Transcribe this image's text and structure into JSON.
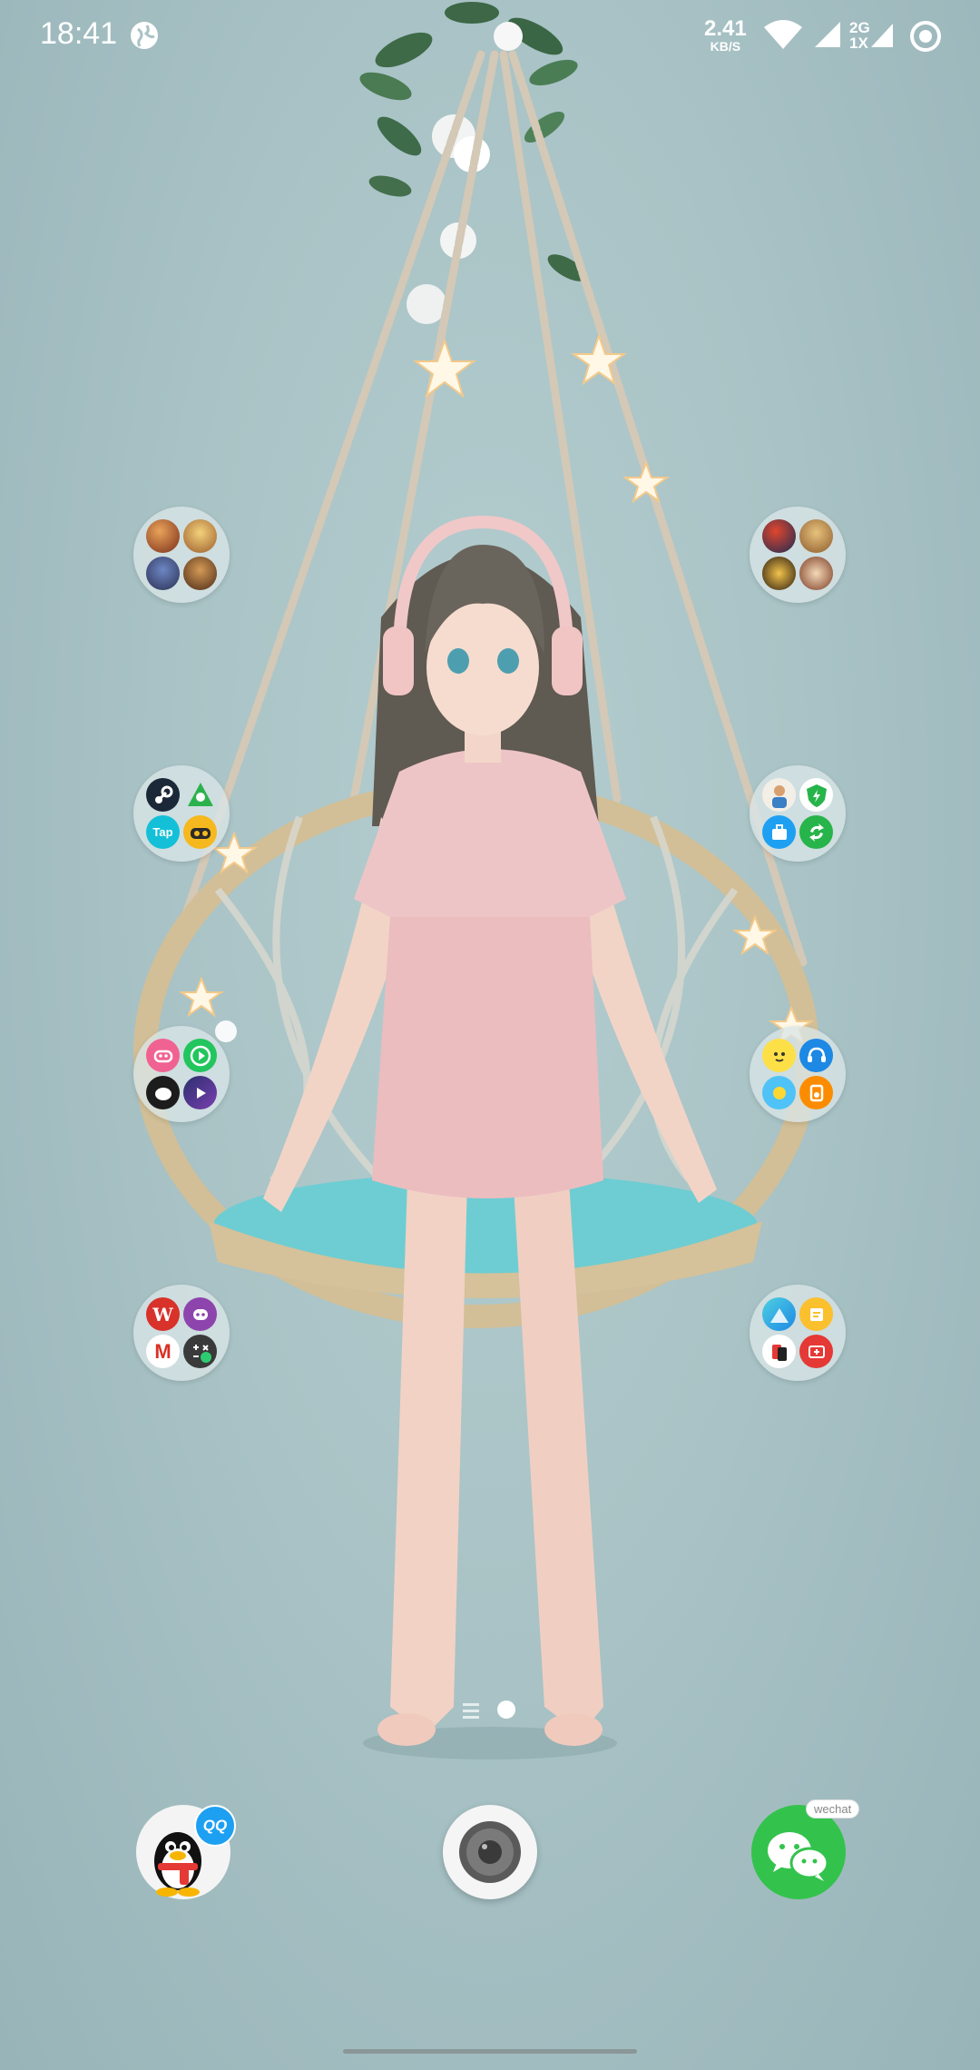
{
  "status_bar": {
    "time": "18:41",
    "network_speed": "2.41",
    "network_speed_unit": "KB/S",
    "signal_label_top": "2G",
    "signal_label_bottom": "1X",
    "icons": [
      "globe-icon",
      "wifi-icon",
      "signal-icon",
      "signal-2g-icon",
      "sync-icon"
    ]
  },
  "folders": [
    {
      "id": "folder-games-1",
      "apps": [
        "game-1",
        "game-2",
        "game-3",
        "game-4"
      ]
    },
    {
      "id": "folder-games-2",
      "apps": [
        "game-5",
        "game-6",
        "game-7",
        "game-8"
      ]
    },
    {
      "id": "folder-game-stores",
      "apps": [
        "steam",
        "play-games",
        "taptap",
        "game-box"
      ]
    },
    {
      "id": "folder-tools",
      "apps": [
        "avatar-app",
        "security-app",
        "toolbox-app",
        "sync-app"
      ]
    },
    {
      "id": "folder-media",
      "apps": [
        "game-center",
        "video-player",
        "chat-app",
        "music-app"
      ]
    },
    {
      "id": "folder-assistants",
      "apps": [
        "emoji-app",
        "headset-app",
        "weather-app",
        "speaker-app"
      ]
    },
    {
      "id": "folder-office",
      "apps": [
        "wps-office",
        "assistant-app",
        "gmail",
        "calculator"
      ]
    },
    {
      "id": "folder-utilities",
      "apps": [
        "maps-app",
        "notes-app",
        "clone-app",
        "oneplus-switch"
      ]
    }
  ],
  "folder_labels": {
    "taptap": "Tap",
    "wps": "W",
    "gmail": "M"
  },
  "dock": {
    "qq_badge": "QQ",
    "wechat_badge": "wechat"
  },
  "colors": {
    "wallpaper": "#a9c3c6",
    "qq_blue": "#1ea0f2",
    "wechat_green": "#33c34d",
    "steam_dark": "#1b2838",
    "taptap_cyan": "#14c0d8",
    "wps_red": "#d8322a"
  }
}
